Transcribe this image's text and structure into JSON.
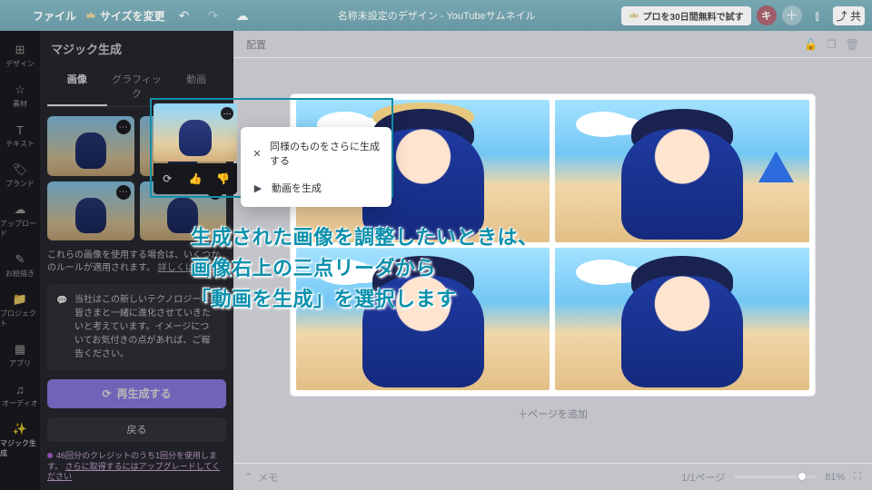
{
  "topbar": {
    "file": "ファイル",
    "resize": "サイズを変更",
    "docname": "名称未設定のデザイン - YouTubeサムネイル",
    "try_pro": "プロを30日間無料で試す",
    "avatar_initial": "キ"
  },
  "rail": {
    "items": [
      {
        "icon": "⊞",
        "label": "デザイン"
      },
      {
        "icon": "☆",
        "label": "素材"
      },
      {
        "icon": "T",
        "label": "テキスト"
      },
      {
        "icon": "🏷",
        "label": "ブランド"
      },
      {
        "icon": "☁",
        "label": "アップロード"
      },
      {
        "icon": "✎",
        "label": "お絵描き"
      },
      {
        "icon": "📁",
        "label": "プロジェクト"
      },
      {
        "icon": "▦",
        "label": "アプリ"
      },
      {
        "icon": "♫",
        "label": "オーディオ"
      },
      {
        "icon": "✨",
        "label": "マジック生成"
      }
    ]
  },
  "panel": {
    "title": "マジック生成",
    "tabs": {
      "image": "画像",
      "graphic": "グラフィック",
      "video": "動画"
    },
    "disclaimer_a": "これらの画像を使用する場合は、いくつかのルールが適用されます。",
    "disclaimer_b": "詳しくはこちら",
    "tip": "当社はこの新しいテクノロジーを皆さまと一緒に進化させていきたいと考えています。イメージについてお気付きの点があれば、ご報告ください。",
    "regenerate": "再生成する",
    "back": "戻る",
    "credit_a": "46回分のクレジットのうち1回分を使用します。",
    "credit_b": "さらに取得するにはアップグレードしてください"
  },
  "ctx": {
    "generate_more": "同様のものをさらに生成する",
    "make_video": "動画を生成"
  },
  "stage": {
    "arrange": "配置",
    "add_page": "＋ページを追加",
    "memo": "メモ",
    "page": "1/1ページ",
    "zoom": "81%"
  },
  "tutorial": {
    "l1": "生成された画像を調整したいときは、",
    "l2": "画像右上の三点リーダから",
    "l3": "「動画を生成」を選択します"
  }
}
